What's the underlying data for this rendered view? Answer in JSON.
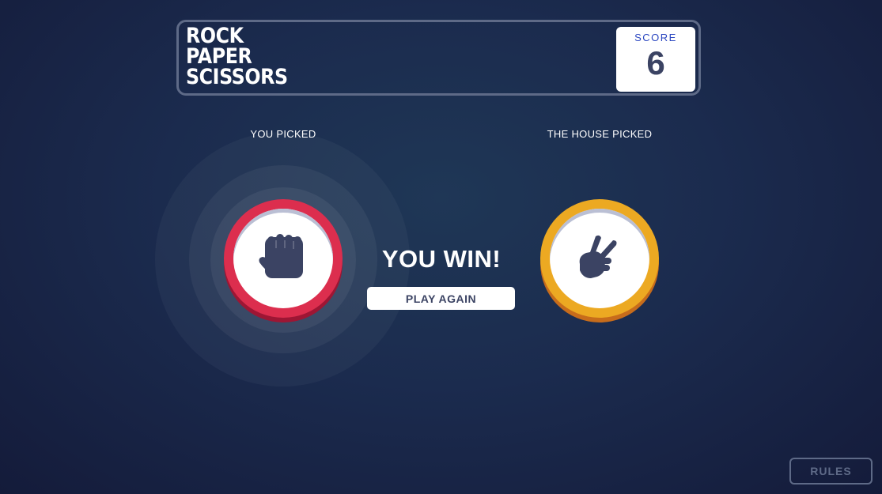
{
  "header": {
    "title_lines": [
      "ROCK",
      "PAPER",
      "SCISSORS"
    ],
    "score_label": "SCORE",
    "score_value": "6"
  },
  "game": {
    "you_picked_label": "YOU PICKED",
    "house_picked_label": "THE HOUSE PICKED",
    "player_choice": "rock",
    "house_choice": "scissors",
    "result_text": "YOU WIN!",
    "play_again_label": "PLAY AGAIN"
  },
  "footer": {
    "rules_label": "RULES"
  },
  "colors": {
    "rock": "#dc2e4e",
    "scissors": "#eca922",
    "icon": "#3b4363",
    "score_label": "#2a46c0"
  },
  "icons": {
    "player": "rock-hand-icon",
    "house": "scissors-hand-icon"
  }
}
